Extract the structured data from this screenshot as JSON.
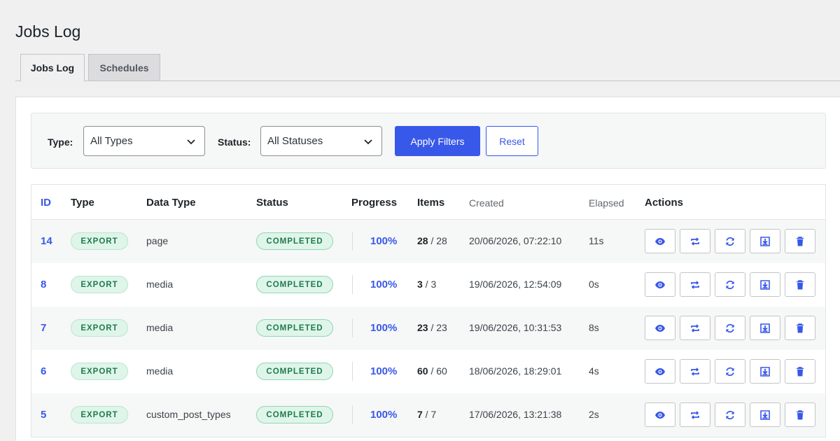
{
  "page": {
    "title": "Jobs Log"
  },
  "tabs": [
    {
      "label": "Jobs Log",
      "active": true
    },
    {
      "label": "Schedules",
      "active": false
    }
  ],
  "filters": {
    "type_label": "Type:",
    "type_value": "All Types",
    "status_label": "Status:",
    "status_value": "All Statuses",
    "apply_label": "Apply Filters",
    "reset_label": "Reset"
  },
  "table": {
    "headers": [
      "ID",
      "Type",
      "Data Type",
      "Status",
      "Progress",
      "Items",
      "Created",
      "Elapsed",
      "Actions"
    ],
    "rows": [
      {
        "id": "14",
        "type": "EXPORT",
        "data_type": "page",
        "status": "COMPLETED",
        "progress": "100%",
        "items_done": "28",
        "items_sep": " / 28",
        "created": "20/06/2026, 07:22:10",
        "elapsed": "11s"
      },
      {
        "id": "8",
        "type": "EXPORT",
        "data_type": "media",
        "status": "COMPLETED",
        "progress": "100%",
        "items_done": "3",
        "items_sep": " / 3",
        "created": "19/06/2026, 12:54:09",
        "elapsed": "0s"
      },
      {
        "id": "7",
        "type": "EXPORT",
        "data_type": "media",
        "status": "COMPLETED",
        "progress": "100%",
        "items_done": "23",
        "items_sep": " / 23",
        "created": "19/06/2026, 10:31:53",
        "elapsed": "8s"
      },
      {
        "id": "6",
        "type": "EXPORT",
        "data_type": "media",
        "status": "COMPLETED",
        "progress": "100%",
        "items_done": "60",
        "items_sep": " / 60",
        "created": "18/06/2026, 18:29:01",
        "elapsed": "4s"
      },
      {
        "id": "5",
        "type": "EXPORT",
        "data_type": "custom_post_types",
        "status": "COMPLETED",
        "progress": "100%",
        "items_done": "7",
        "items_sep": " / 7",
        "created": "17/06/2026, 13:21:38",
        "elapsed": "2s"
      }
    ],
    "actions": [
      "eye-icon",
      "repeat-icon",
      "refresh-icon",
      "download-icon",
      "trash-icon"
    ]
  },
  "colors": {
    "accent": "#3858e9",
    "badge_bg": "#dff5ea",
    "badge_text": "#1f7a4d"
  }
}
